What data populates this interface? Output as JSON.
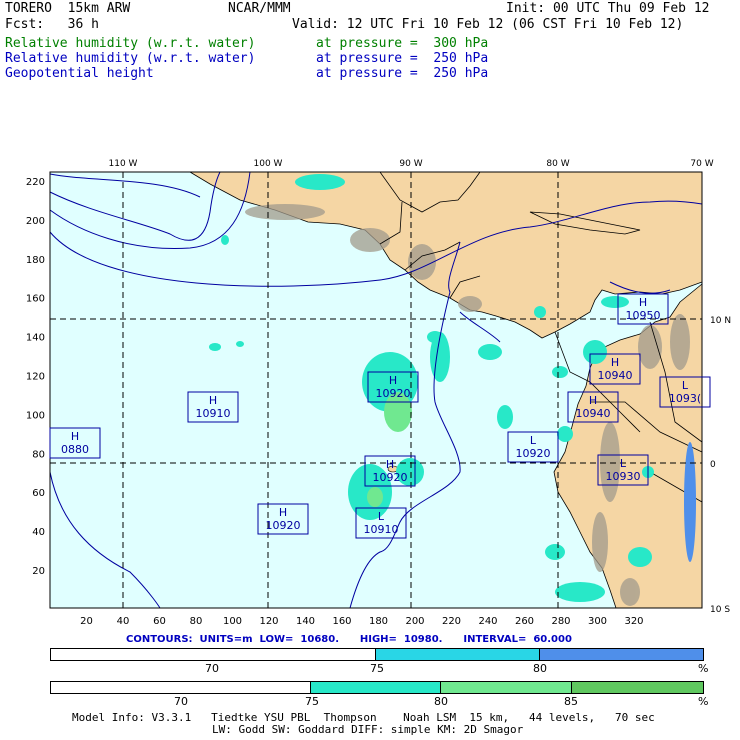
{
  "header": {
    "model": "TORERO  15km ARW",
    "center": "NCAR/MMM",
    "init": "Init: 00 UTC Thu 09 Feb 12",
    "fcst": "Fcst:   36 h",
    "valid": "Valid: 12 UTC Fri 10 Feb 12 (06 CST Fri 10 Feb 12)",
    "fields": [
      {
        "name": "Relative humidity (w.r.t. water)",
        "level": "at pressure =  300 hPa",
        "color": "#008000"
      },
      {
        "name": "Relative humidity (w.r.t. water)",
        "level": "at pressure =  250 hPa",
        "color": "#0000c0"
      },
      {
        "name": "Geopotential height",
        "level": "at pressure =  250 hPa",
        "color": "#0000c0"
      }
    ]
  },
  "map": {
    "lon_labels": [
      "110 W",
      "100 W",
      "90 W",
      "80 W",
      "70 W"
    ],
    "lat_labels": [
      "10 N",
      "0",
      "10 S"
    ],
    "grid_x_ticks": [
      "20",
      "40",
      "60",
      "80",
      "100",
      "120",
      "140",
      "160",
      "180",
      "200",
      "220",
      "240",
      "260",
      "280",
      "300",
      "320"
    ],
    "grid_y_ticks": [
      "220",
      "200",
      "180",
      "160",
      "140",
      "120",
      "100",
      "80",
      "60",
      "40",
      "20"
    ],
    "ocean_color": "#e0ffff",
    "land_color": "#f5d6a4",
    "contour_color": "#0000a0",
    "highs_lows": [
      {
        "type": "H",
        "value": "10950"
      },
      {
        "type": "H",
        "value": "10940"
      },
      {
        "type": "H",
        "value": "10940"
      },
      {
        "type": "L",
        "value": "1093("
      },
      {
        "type": "H",
        "value": "10920"
      },
      {
        "type": "H",
        "value": "10910"
      },
      {
        "type": "H",
        "value": "0880"
      },
      {
        "type": "L",
        "value": "10920"
      },
      {
        "type": "H",
        "value": "10920"
      },
      {
        "type": "L",
        "value": "10930"
      },
      {
        "type": "H",
        "value": "10920"
      },
      {
        "type": "L",
        "value": "10910"
      }
    ]
  },
  "contours": "CONTOURS:  UNITS=m  LOW=  10680.      HIGH=  10980.      INTERVAL=  60.000",
  "bar250": {
    "labels": [
      "70",
      "75",
      "80",
      "%"
    ],
    "colors": [
      "#ffffff",
      "#29d6e6",
      "#4f8fea"
    ]
  },
  "bar300": {
    "labels": [
      "70",
      "75",
      "80",
      "85",
      "%"
    ],
    "colors": [
      "#ffffff",
      "#28e8c8",
      "#70e890",
      "#60c860"
    ]
  },
  "footer": {
    "line1": "Model Info: V3.3.1   Tiedtke YSU PBL  Thompson    Noah LSM  15 km,   44 levels,   70 sec",
    "line2": "LW: Godd SW: Goddard DIFF: simple KM: 2D Smagor"
  }
}
